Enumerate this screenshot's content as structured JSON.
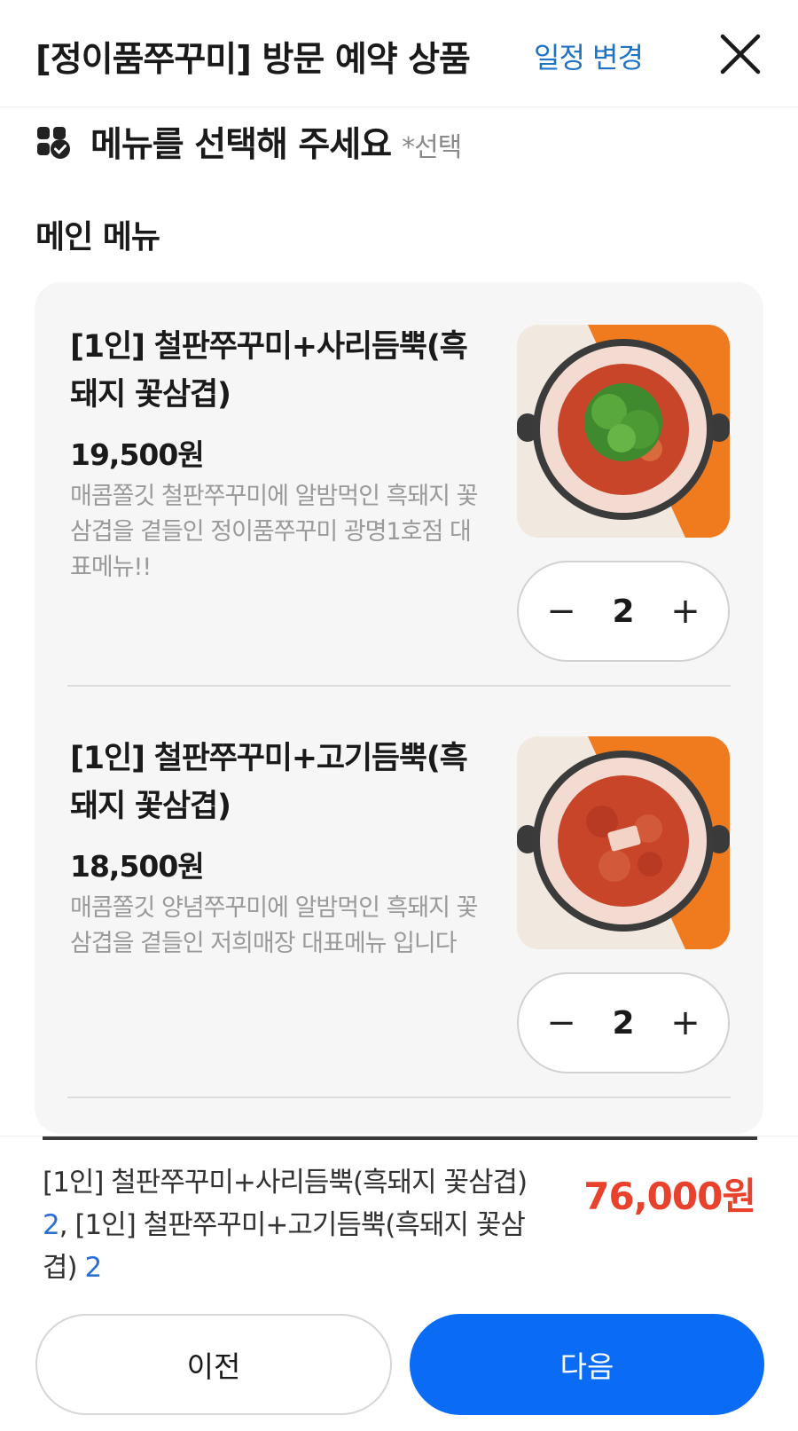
{
  "header": {
    "title": "[정이품쭈꾸미] 방문 예약 상품",
    "change_label": "일정 변경",
    "close_icon": "close-icon"
  },
  "section": {
    "icon": "menu-check-icon",
    "title": "메뉴를 선택해 주세요",
    "required": "*선택"
  },
  "group": {
    "title": "메인 메뉴"
  },
  "menu_items": [
    {
      "name": "[1인] 철판쭈꾸미+사리듬뿍(흑돼지 꽃삼겹)",
      "price": "19,500원",
      "description": "매콤쫄깃 철판쭈꾸미에 알밤먹인 흑돼지 꽃삼겹을 곁들인 정이품쭈꾸미 광명1호점 대표메뉴!!",
      "quantity": "2",
      "image": "food-photo-sari"
    },
    {
      "name": "[1인] 철판쭈꾸미+고기듬뿍(흑돼지 꽃삼겹)",
      "price": "18,500원",
      "description": "매콤쫄깃 양념쭈꾸미에 알밤먹인 흑돼지 꽃삼겹을 곁들인 저희매장 대표메뉴 입니다",
      "quantity": "2",
      "image": "food-photo-gogi"
    }
  ],
  "stepper": {
    "minus": "−",
    "plus": "+"
  },
  "summary": {
    "item1": "[1인] 철판쭈꾸미+사리듬뿍(흑돼지 꽃삼겹)",
    "qty1": "2",
    "separator": ", ",
    "item2": "[1인] 철판쭈꾸미+고기듬뿍(흑돼지 꽃삼겹)",
    "qty2": "2",
    "total": "76,000원"
  },
  "buttons": {
    "prev": "이전",
    "next": "다음"
  },
  "colors": {
    "accent_blue": "#0a6cf5",
    "link_blue": "#1f73c7",
    "price_red": "#e8412c",
    "card_bg": "#f6f6f6"
  }
}
